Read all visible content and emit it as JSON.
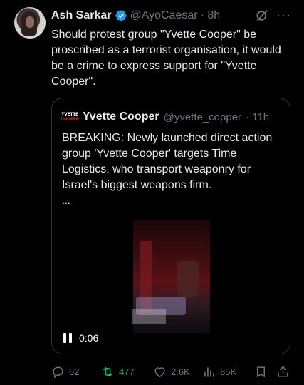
{
  "tweet": {
    "author_name": "Ash Sarkar",
    "author_handle": "@AyoCaesar",
    "time": "· 8h",
    "text": "Should protest group \"Yvette Cooper\" be proscribed as a terrorist organisation, it would be a crime to express support for \"Yvette Cooper\".",
    "verified": true
  },
  "quote": {
    "avatar_line1": "YVETTE",
    "avatar_line2": "COOPER",
    "author_name": "Yvette Cooper",
    "author_handle": "@yvette_copper",
    "time": "· 11h",
    "text": "BREAKING: Newly launched direct action group 'Yvette Cooper' targets Time Logistics, who transport weaponry for Israel's biggest weapons firm.",
    "ellipsis": "...",
    "video_time": "0:06"
  },
  "actions": {
    "replies": "62",
    "retweets": "477",
    "likes": "2.6K",
    "views": "85K"
  },
  "colors": {
    "background": "#000000",
    "text": "#e7e9ea",
    "muted": "#71767b",
    "verified": "#1d9bf0",
    "retweet_active": "#00ba7c",
    "border": "#2f3336"
  },
  "icons": [
    "verified-badge-icon",
    "grok-icon",
    "more-icon",
    "pause-icon",
    "reply-icon",
    "retweet-icon",
    "like-icon",
    "views-icon",
    "bookmark-icon",
    "share-icon"
  ]
}
